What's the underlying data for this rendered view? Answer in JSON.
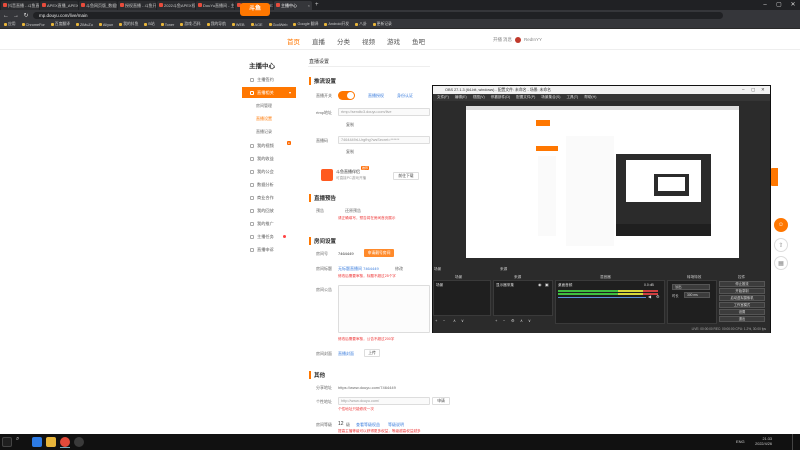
{
  "browser": {
    "tabs": [
      {
        "label": "抖音直播 - 斗鱼直播"
      },
      {
        "label": "APEX直播_APEX直播..."
      },
      {
        "label": "斗鱼网页版_数据统计"
      },
      {
        "label": "授权直播 - 斗鱼开放平台"
      },
      {
        "label": "2022斗鱼APEX视频..."
      },
      {
        "label": "DouYu直播间 - 主播中心"
      },
      {
        "label": "斗鱼直播间_APEX..."
      },
      {
        "label": "主播中心"
      }
    ],
    "new_tab": "+",
    "win_min": "–",
    "win_max": "▢",
    "win_close": "✕",
    "back": "←",
    "forward": "→",
    "reload": "↻",
    "url": "mp.douyu.com/live/main",
    "bookmarks": [
      "应用",
      "ChromeFor",
      "百度翻译",
      "ZiMuZu",
      "Aliyun",
      "我的抖鱼",
      "B站",
      "Toner",
      "游戏-百科",
      "我的导航",
      "WEB",
      "AGE",
      "GodWeb",
      "Google 翻译",
      "Android开发",
      "八卦",
      "更新记录"
    ]
  },
  "site": {
    "logo": "斗鱼",
    "nav": [
      "首页",
      "直播",
      "分类",
      "视频",
      "游戏",
      "鱼吧"
    ],
    "hdr_right": [
      "开播",
      "消息"
    ],
    "username": "RedInYY"
  },
  "sidebar": {
    "title": "主播中心",
    "items": [
      "主播签约",
      "直播相关",
      "我的视频",
      "我的收益",
      "我的公会",
      "数据分析",
      "商业合作",
      "我的回放",
      "我的推广",
      "主播任务",
      "直播申诉"
    ],
    "subs": [
      "房间管理",
      "直播设置",
      "直播记录"
    ]
  },
  "main": {
    "tab_title": "直播设置",
    "sec_push": "推流设置",
    "lbl_stream": "直播开关",
    "link_auth": "直播授权",
    "link_cert": "身份认证",
    "lbl_rtmp": "rtmp地址",
    "rtmp_value": "rtmp://sendtc3.douyu.com/live",
    "copy1": "复制",
    "lbl_code": "直播码",
    "code_value": "7464449rLUrgfhg?wsSecret=******",
    "copy2": "复制",
    "tool_title": "斗鱼直播伴侣",
    "tool_sub": "可直接PC游戏开播",
    "tool_badge": "推荐",
    "download": "前往下载",
    "sec_preview": "直播预告",
    "lbl_preview": "预告",
    "preview_state": "还原预告",
    "preview_warn": "请正确填写，预告将在房间首页展示",
    "sec_room": "房间设置",
    "lbl_roomid": "房间号",
    "room_id": "7464449",
    "btn_room": "申请靓号房间",
    "lbl_roomname": "房间标题",
    "room_name": "无标题直播间 7464449",
    "edit": "修改",
    "name_warn": "修改后需要审核，标题不超过25个字",
    "lbl_notice": "房间公告",
    "notice_warn": "修改后需要审核，公告不超过200字",
    "lbl_cover": "房间封面",
    "cover_link": "直播封面",
    "cover_btn": "上传",
    "sec_other": "其他",
    "lbl_share": "分享地址",
    "share_url": "https://www.douyu.com/7464449",
    "lbl_custom": "个性地址",
    "custom_url": "http://www.douyu.com/",
    "apply": "申请",
    "custom_tip": "个性地址只能修改一次",
    "lbl_level": "房间等级",
    "level": "12",
    "level_unit": "级",
    "level_link1": "查看等级权益",
    "level_link2": "等级说明",
    "level_warn": "提高主播等级可以获得更多权益，等级越高权益越多"
  },
  "obs": {
    "title": "OBS 27.1.3 (64-bit, windows) - 配置文件: 未命名 - 场景: 未命名",
    "menu": [
      "文件(F)",
      "编辑(E)",
      "视图(V)",
      "停靠部件(D)",
      "配置文件(P)",
      "场景集合(S)",
      "工具(T)",
      "帮助(H)"
    ],
    "docks": {
      "scenes": "场景",
      "sources": "来源",
      "mixer": "混音器",
      "transitions": "转场特效",
      "controls": "控件"
    },
    "scene_item": "场景",
    "source_item": "显示器采集",
    "mixer_label": "桌面音频",
    "mixer_db": "0.0 dB",
    "transition": "淡出",
    "duration_lbl": "时长",
    "duration": "300 ms",
    "controls": [
      "停止推流",
      "开始录制",
      "启动虚拟摄像机",
      "工作室模式",
      "设置",
      "退出"
    ],
    "status": "LIVE: 00:00:00   REC: 00:00:00   CPU: 1.2%, 30.00 fps",
    "add": "+",
    "remove": "−",
    "up": "∧",
    "down": "∨",
    "gear": "⚙"
  },
  "taskbar": {
    "time": "21:33",
    "date": "2022/4/26",
    "ime": "ENG",
    "search": "⌕"
  },
  "colors": {
    "accent": "#ff7700",
    "link": "#3b7ddd",
    "warn": "#e33333"
  }
}
